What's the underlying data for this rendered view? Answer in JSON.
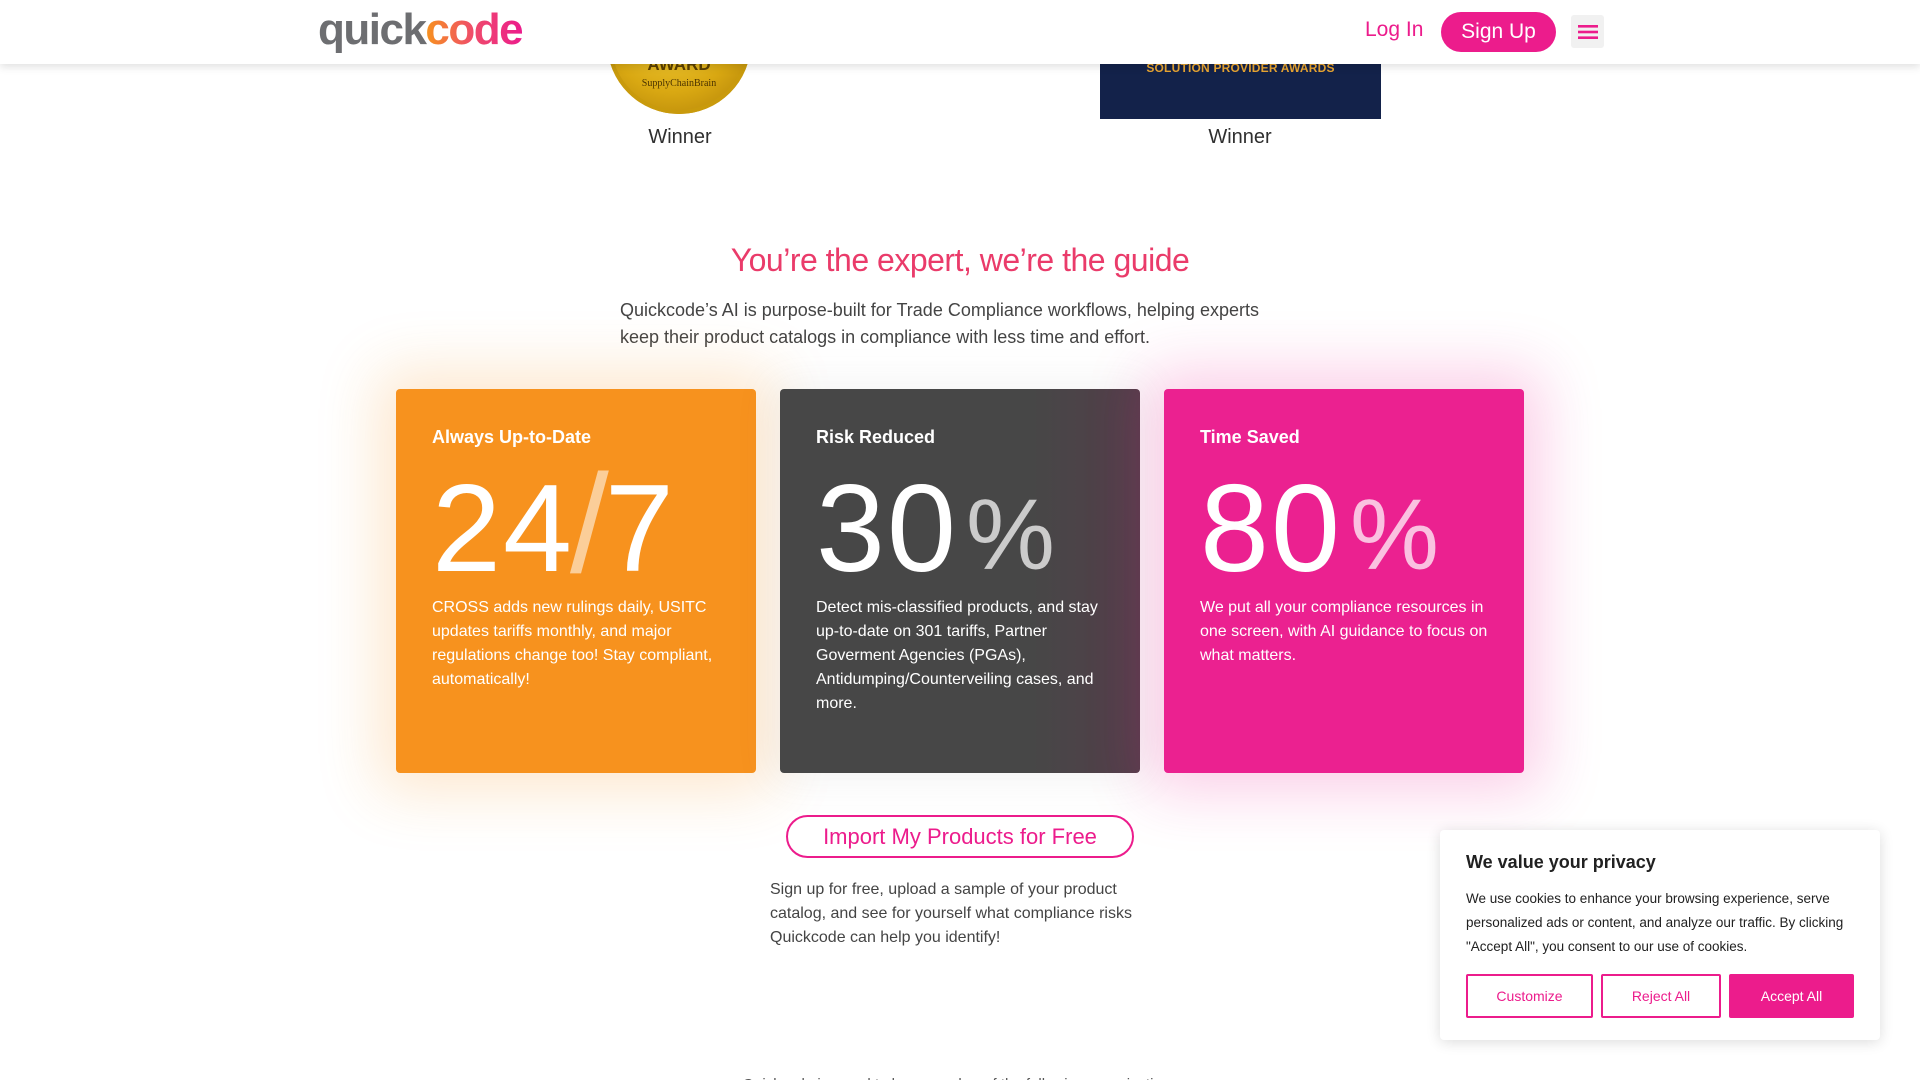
{
  "header": {
    "logo_part1": "quick",
    "logo_part2": "code",
    "login_label": "Log In",
    "signup_label": "Sign Up",
    "menu_icon": "hamburger-menu-icon"
  },
  "awards": [
    {
      "badge_text": "AWARD",
      "badge_subtext": "SupplyChainBrain",
      "caption": "Winner"
    },
    {
      "badge_text": "SOLUTION PROVIDER AWARDS",
      "caption": "Winner"
    }
  ],
  "intro": {
    "title": "You’re the expert, we’re the guide",
    "description": "Quickcode’s AI is purpose-built for Trade Compliance workflows, helping experts keep their product catalogs in compliance with less time and effort."
  },
  "cards": [
    {
      "label": "Always Up-to-Date",
      "big_a": "24",
      "big_sep": "/",
      "big_b": "7",
      "text": "CROSS adds new rulings daily, USITC updates tariffs monthly, and major regulations change too! Stay compliant, automatically!"
    },
    {
      "label": "Risk Reduced",
      "big_a": "30",
      "suffix": "%",
      "text": "Detect mis-classified products, and stay up-to-date on 301 tariffs, Partner Goverment Agencies (PGAs), Antidumping/Counterveiling cases, and more."
    },
    {
      "label": "Time Saved",
      "big_a": "80",
      "suffix": "%",
      "text": "We put all your compliance resources in one screen, with AI guidance to focus on what matters."
    }
  ],
  "cta": {
    "button_label": "Import My Products for Free",
    "description": "Sign up for free, upload a sample of your product catalog, and see for yourself what compliance risks Quickcode can help you identify!"
  },
  "footer_partial": "Quickcode is proud to be a member of the following organizations",
  "cookie": {
    "title": "We value your privacy",
    "text": "We use cookies to enhance your browsing experience, serve personalized ads or content, and analyze our traffic. By clicking \"Accept All\", you consent to our use of cookies.",
    "customize_label": "Customize",
    "reject_label": "Reject All",
    "accept_label": "Accept All"
  },
  "colors": {
    "brand_pink": "#ec1c8c",
    "brand_orange": "#f7921e",
    "card_dark": "#474747",
    "title_red": "#ea3b6a"
  }
}
